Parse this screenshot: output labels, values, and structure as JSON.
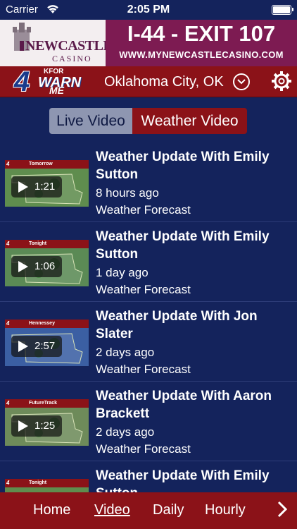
{
  "status_bar": {
    "carrier": "Carrier",
    "time": "2:05 PM"
  },
  "ad": {
    "logo_line1": "NEWCASTLE",
    "logo_line2": "CASINO",
    "headline": "I-44 - EXIT 107",
    "url": "WWW.MYNEWCASTLECASINO.COM"
  },
  "header": {
    "brand": {
      "number": "4",
      "station": "KFOR",
      "warn": "WARN",
      "me": "ME"
    },
    "location": "Oklahoma City, OK"
  },
  "segments": {
    "live": "Live Video",
    "weather": "Weather Video",
    "selected": "Weather Video"
  },
  "videos": [
    {
      "title": "Weather Update With Emily Sutton",
      "ago": "8 hours ago",
      "category": "Weather Forecast",
      "duration": "1:21",
      "thumb_label": "Tomorrow"
    },
    {
      "title": "Weather Update With Emily Sutton",
      "ago": "1 day ago",
      "category": "Weather Forecast",
      "duration": "1:06",
      "thumb_label": "Tonight"
    },
    {
      "title": "Weather Update With Jon Slater",
      "ago": "2 days ago",
      "category": "Weather Forecast",
      "duration": "2:57",
      "thumb_label": "Hennessey"
    },
    {
      "title": "Weather Update With Aaron Brackett",
      "ago": "2 days ago",
      "category": "Weather Forecast",
      "duration": "1:25",
      "thumb_label": "FutureTrack"
    },
    {
      "title": "Weather Update With Emily Sutton",
      "ago": "",
      "category": "",
      "duration": "",
      "thumb_label": "Tonight"
    }
  ],
  "nav": {
    "home": "Home",
    "video": "Video",
    "daily": "Daily",
    "hourly": "Hourly",
    "active": "Video"
  },
  "colors": {
    "background": "#14235c",
    "brand_red": "#8b1218",
    "casino_purple": "#7d1b52",
    "segment_inactive": "#8e96b1"
  }
}
